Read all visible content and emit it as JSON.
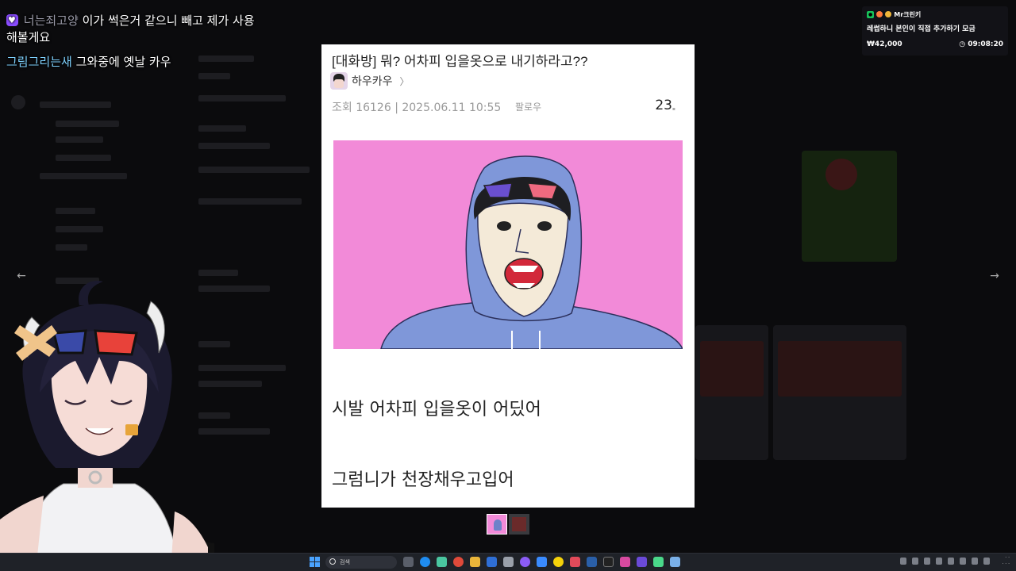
{
  "chat": {
    "messages": [
      {
        "nick": "너는죄고양",
        "text": "이가 썩은거 같으니 빼고 제가 사용해볼게요"
      },
      {
        "nick": "그림그리는새",
        "text": "그와중에 옛날 카우"
      }
    ]
  },
  "donation": {
    "name": "Mr크린키",
    "message": "레썹하니 본인이 직접 추가하기 모금",
    "amount": "₩42,000",
    "time": "09:08:20"
  },
  "post": {
    "title": "[대화방] 뭐? 어차피 입을옷으로 내기하라고??",
    "author": "하우카우",
    "author_chevron": "〉",
    "meta": "조회 16126 | 2025.06.11 10:55",
    "follow": "팔로우",
    "count": "23",
    "body_line1": "시발 어차피 입을옷이 어딨어",
    "body_line2": "그럼니가 천장채우고입어"
  },
  "gallery": {
    "prev": "←",
    "next": "→"
  },
  "taskbar": {
    "search_placeholder": "검색"
  },
  "colors": {
    "image_bg": "#f28ad8",
    "hoodie": "#7f97d9",
    "chat_nick_highlight": "#7fd2ff",
    "badge": "#8a4cff"
  }
}
